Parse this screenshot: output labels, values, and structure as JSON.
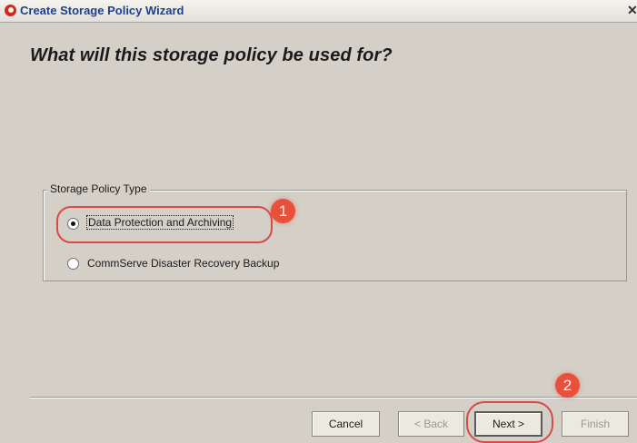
{
  "window": {
    "title": "Create Storage Policy Wizard",
    "close_glyph": "✕",
    "icon": "commvault-logo-icon"
  },
  "heading": "What will this storage policy be used for?",
  "group": {
    "label": "Storage Policy Type",
    "options": [
      {
        "label": "Data Protection and Archiving",
        "selected": true
      },
      {
        "label": "CommServe Disaster Recovery Backup",
        "selected": false
      }
    ]
  },
  "annotations": {
    "step1": "1",
    "step2": "2",
    "color": "#e8503c"
  },
  "buttons": {
    "cancel": "Cancel",
    "back": "< Back",
    "next": "Next >",
    "finish": "Finish"
  }
}
